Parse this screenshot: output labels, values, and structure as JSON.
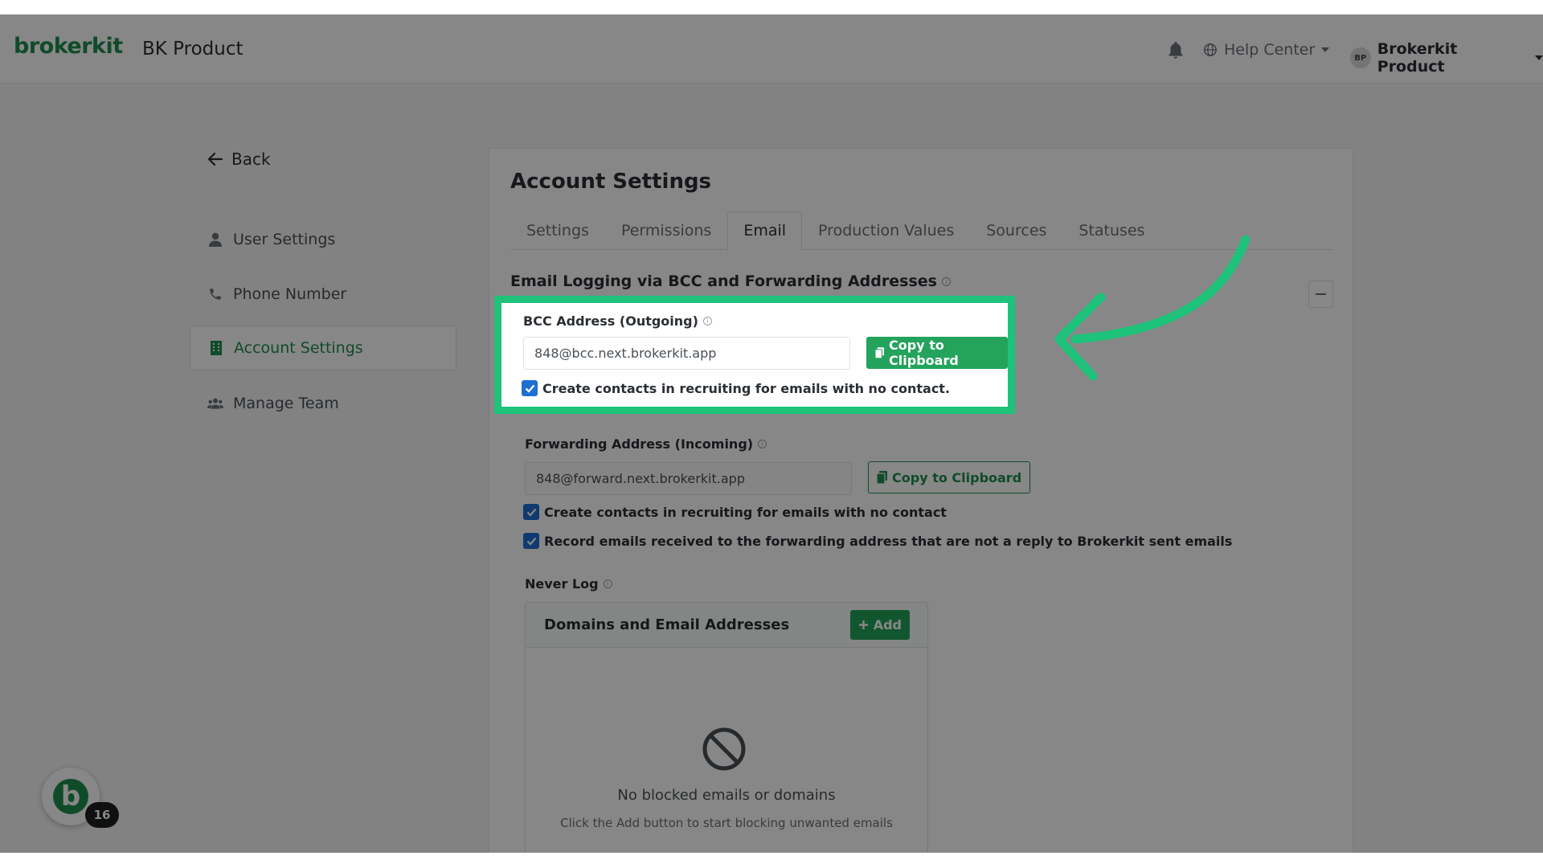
{
  "brand": {
    "logo": "brokerkit",
    "product": "BK Product"
  },
  "navbar": {
    "help_label": "Help Center",
    "user_initials": "BP",
    "user_name": "Brokerkit Product"
  },
  "sidebar": {
    "back_label": "Back",
    "items": [
      {
        "label": "User Settings",
        "icon": "user-icon"
      },
      {
        "label": "Phone Number",
        "icon": "phone-icon"
      },
      {
        "label": "Account Settings",
        "icon": "building-icon"
      },
      {
        "label": "Manage Team",
        "icon": "users-icon"
      }
    ]
  },
  "page": {
    "title": "Account Settings",
    "tabs": [
      "Settings",
      "Permissions",
      "Email",
      "Production Values",
      "Sources",
      "Statuses"
    ],
    "active_tab": "Email",
    "section_title": "Email Logging via BCC and Forwarding Addresses"
  },
  "bcc": {
    "label": "BCC Address (Outgoing)",
    "value": "848@bcc.next.brokerkit.app",
    "copy_label": "Copy to Clipboard",
    "checkbox_label": "Create contacts in recruiting for emails with no contact."
  },
  "forwarding": {
    "label": "Forwarding Address (Incoming)",
    "value": "848@forward.next.brokerkit.app",
    "copy_label": "Copy to Clipboard",
    "checkbox1_label": "Create contacts in recruiting for emails with no contact",
    "checkbox2_label": "Record emails received to the forwarding address that are not a reply to Brokerkit sent emails"
  },
  "never_log": {
    "label": "Never Log",
    "panel_title": "Domains and Email Addresses",
    "add_label": "Add",
    "empty_title": "No blocked emails or domains",
    "empty_subtitle": "Click the Add button to start blocking unwanted emails"
  },
  "widget": {
    "letter": "b",
    "badge_count": "16"
  },
  "colors": {
    "brand_green": "#1f8f4e",
    "highlight_green": "#1ec27a",
    "checkbox_blue": "#1f6fd1"
  }
}
